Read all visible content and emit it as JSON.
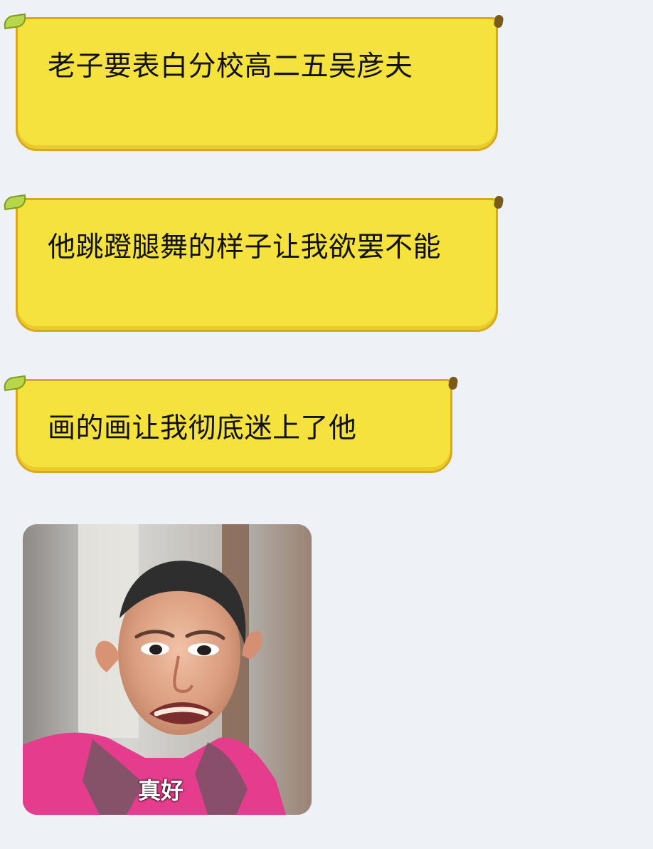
{
  "messages": [
    {
      "text": "老子要表白分校高二五吴彦夫"
    },
    {
      "text": "他跳蹬腿舞的样子让我欲罢不能"
    },
    {
      "text": "画的画让我彻底迷上了他"
    }
  ],
  "sticker": {
    "caption": "真好"
  },
  "colors": {
    "background": "#eef1f6",
    "bubble": "#f6e23c",
    "bubble_border": "#d8a81f"
  },
  "icons": [
    "banana-stem-icon",
    "banana-tip-icon"
  ]
}
